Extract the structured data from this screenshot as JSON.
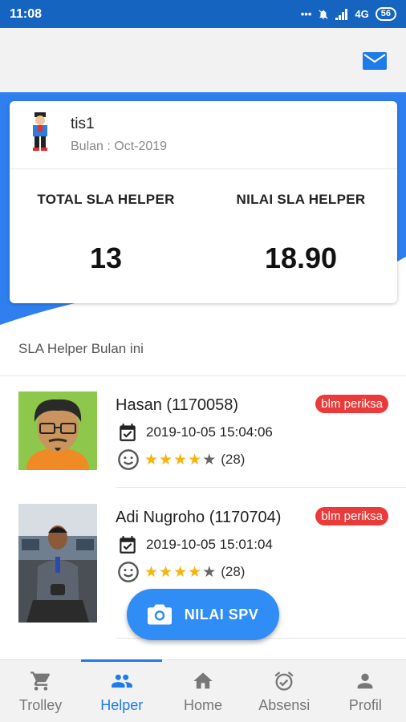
{
  "status_bar": {
    "time": "11:08",
    "signal": "4G",
    "battery": "56"
  },
  "summary": {
    "user_name": "tis1",
    "month_label": "Bulan : Oct-2019",
    "total_label": "TOTAL SLA HELPER",
    "total_value": "13",
    "score_label": "NILAI SLA HELPER",
    "score_value": "18.90"
  },
  "section_title": "SLA Helper Bulan ini",
  "items": [
    {
      "name": "Hasan (1170058)",
      "badge": "blm periksa",
      "datetime": "2019-10-05 15:04:06",
      "rating": 4,
      "count": "(28)"
    },
    {
      "name": "Adi Nugroho (1170704)",
      "badge": "blm periksa",
      "datetime": "2019-10-05 15:01:04",
      "rating": 4,
      "count": "(28)"
    }
  ],
  "fab_label": "NILAI SPV",
  "nav": [
    {
      "label": "Trolley",
      "icon": "cart-icon"
    },
    {
      "label": "Helper",
      "icon": "people-icon"
    },
    {
      "label": "Home",
      "icon": "home-icon"
    },
    {
      "label": "Absensi",
      "icon": "alarm-icon"
    },
    {
      "label": "Profil",
      "icon": "person-icon"
    }
  ],
  "colors": {
    "primary": "#2f7ff0",
    "badge": "#ea3a3a",
    "star": "#f5b50a"
  }
}
